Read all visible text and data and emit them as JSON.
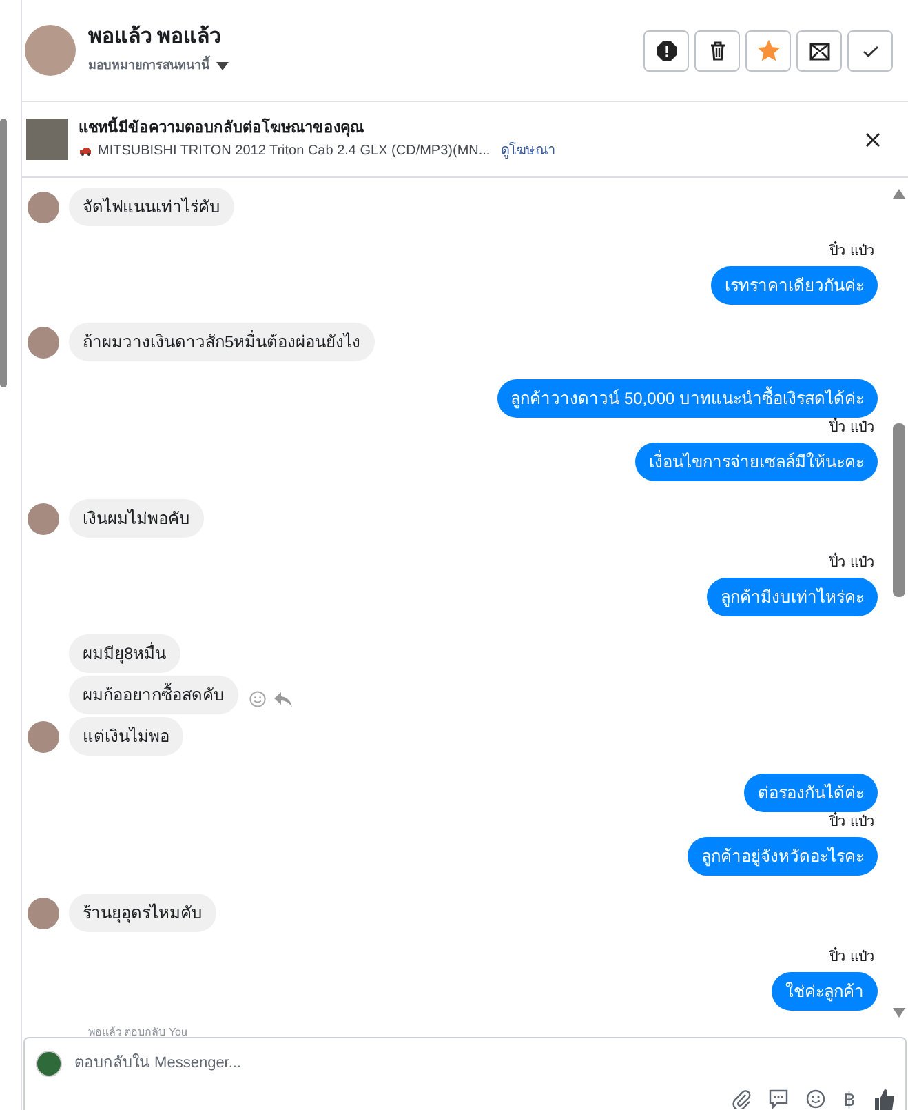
{
  "header": {
    "name": "พอแล้ว พอแล้ว",
    "assign_label": "มอบหมายการสนทนานี้",
    "actions": [
      {
        "kind": "spam"
      },
      {
        "kind": "delete"
      },
      {
        "kind": "star",
        "selected": true
      },
      {
        "kind": "unread"
      },
      {
        "kind": "done"
      }
    ]
  },
  "ad_banner": {
    "title": "แชทนี้มีข้อความตอบกลับต่อโฆษณาของคุณ",
    "subtitle": "MITSUBISHI TRITON 2012 Triton Cab 2.4 GLX (CD/MP3)(MN...",
    "link": "ดูโฆษณา"
  },
  "messages": [
    {
      "kind": "received",
      "text": "จัดไฟแนนเท่าไร่คับ",
      "avatar": true
    },
    {
      "kind": "sent",
      "sender": "ปิ๋ว แป๋ว",
      "text": "เรทราคาเดียวกันค่ะ"
    },
    {
      "kind": "received",
      "text": "ถ้าผมวางเงินดาวสัก5หมื่นต้องผ่อนยังไง",
      "avatar": true
    },
    {
      "kind": "sent",
      "text": "ลูกค้าวางดาวน์ 50,000  บาทแนะนำซื้อเงิรสดได้ค่ะ"
    },
    {
      "kind": "sent",
      "sender": "ปิ๋ว แป๋ว",
      "text": "เงื่อนไขการจ่ายเซลล์มีให้นะคะ"
    },
    {
      "kind": "received",
      "text": "เงินผมไม่พอคับ",
      "avatar": true
    },
    {
      "kind": "sent",
      "sender": "ปิ๋ว แป๋ว",
      "text": "ลูกค้ามีงบเท่าไหร่คะ"
    },
    {
      "kind": "received",
      "text": "ผมมียุ8หมื่น",
      "avatar": false
    },
    {
      "kind": "received",
      "text": "ผมก้ออยากซื้อสดคับ",
      "avatar": false,
      "hovered": true
    },
    {
      "kind": "received",
      "text": "แต่เงินไม่พอ",
      "avatar": true
    },
    {
      "kind": "sent",
      "text": "ต่อรองกันได้ค่ะ"
    },
    {
      "kind": "sent",
      "sender": "ปิ๋ว แป๋ว",
      "text": "ลูกค้าอยู่จังหวัดอะไรคะ"
    },
    {
      "kind": "received",
      "text": "ร้านยุอุดรไหมคับ",
      "avatar": true
    },
    {
      "kind": "sent",
      "sender": "ปิ๋ว แป๋ว",
      "text": "ใช่ค่ะลูกค้า"
    }
  ],
  "seen_note": "พอแล้ว ตอบกลับ You",
  "composer": {
    "placeholder": "ตอบกลับใน Messenger...",
    "currency_symbol": "฿"
  }
}
